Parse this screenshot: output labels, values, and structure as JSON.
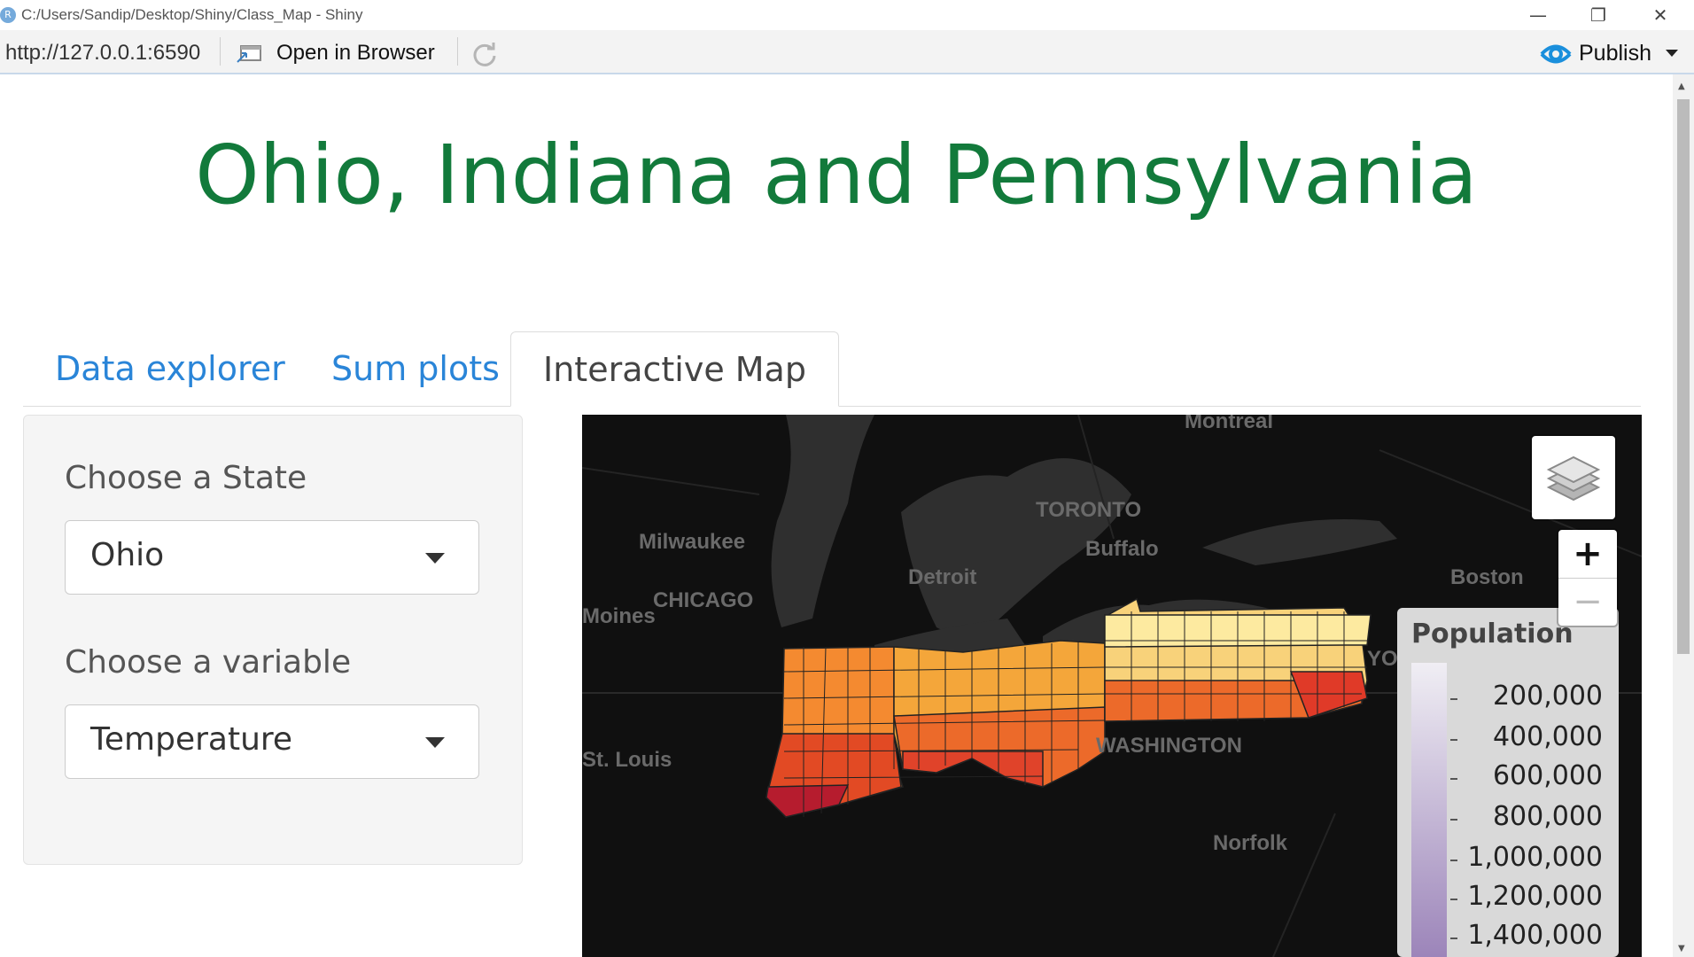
{
  "window": {
    "title": "C:/Users/Sandip/Desktop/Shiny/Class_Map - Shiny",
    "icon_letter": "R",
    "minimize": "—",
    "restore": "❐",
    "close": "✕"
  },
  "toolbar": {
    "url": "http://127.0.0.1:6590",
    "open_in_browser": "Open in Browser",
    "publish": "Publish"
  },
  "app": {
    "title": "Ohio, Indiana and Pennsylvania",
    "tabs": [
      {
        "label": "Data explorer",
        "active": false
      },
      {
        "label": "Sum plots",
        "active": false
      },
      {
        "label": "Interactive Map",
        "active": true
      }
    ],
    "sidebar": {
      "state_label": "Choose a State",
      "state_value": "Ohio",
      "variable_label": "Choose a variable",
      "variable_value": "Temperature"
    }
  },
  "map": {
    "zoom_in": "+",
    "zoom_out": "−",
    "cities": [
      "Montreal",
      "TORONTO",
      "Milwaukee",
      "Buffalo",
      "Detroit",
      "CHICAGO",
      "Moines",
      "Boston",
      "YORK",
      "WASHINGTON",
      "St. Louis",
      "Norfolk"
    ],
    "legend": {
      "title": "Population",
      "values": [
        "200,000",
        "400,000",
        "600,000",
        "800,000",
        "1,000,000",
        "1,200,000",
        "1,400,000"
      ]
    },
    "colors": {
      "background": "#0d0d0d",
      "land": "#1c1c1c",
      "lakes": "#2e2e2e",
      "legend_low": "#f0eef4",
      "legend_high": "#9a82b8"
    }
  }
}
